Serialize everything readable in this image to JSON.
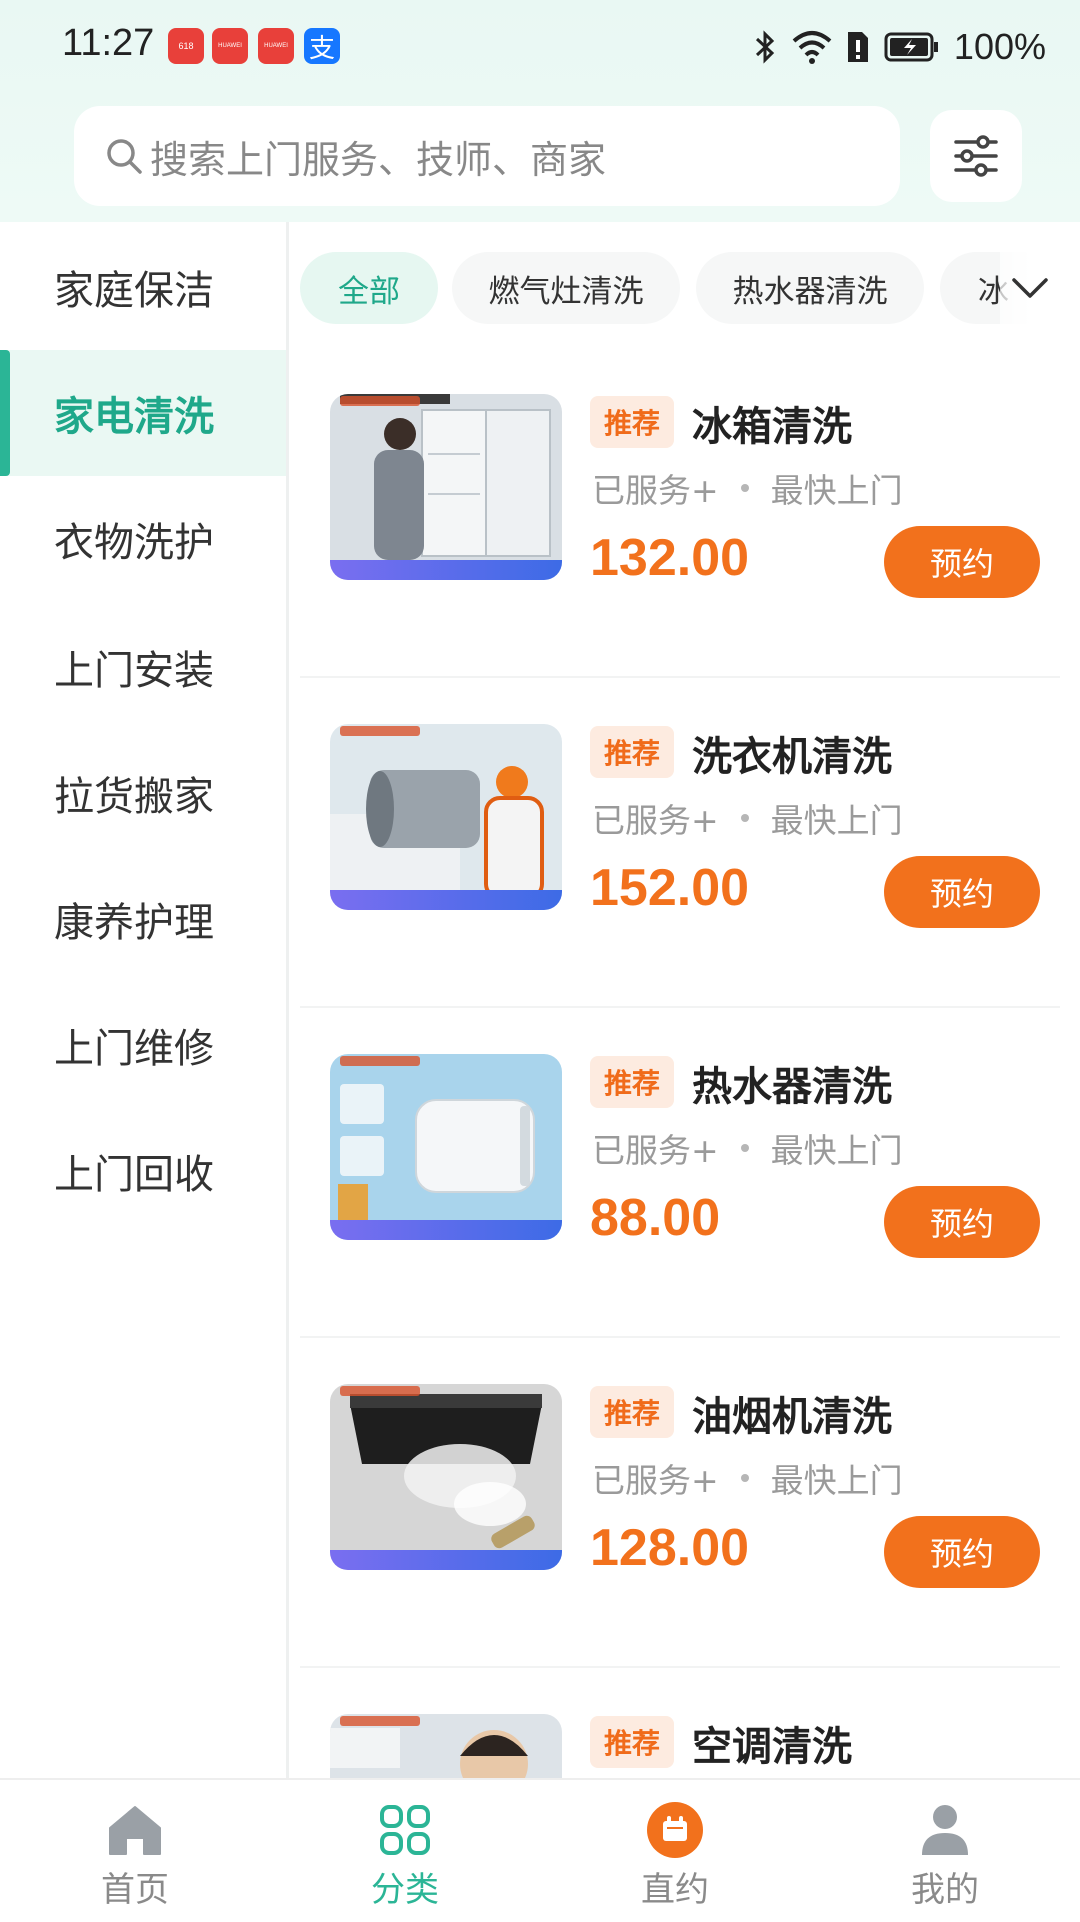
{
  "status_bar": {
    "time": "11:27",
    "battery": "100%",
    "app_icons": [
      {
        "name": "618-app-icon",
        "label": "618",
        "color": "#e8403a"
      },
      {
        "name": "huawei-app-icon",
        "label": "HUAWEI",
        "color": "#e8403a"
      },
      {
        "name": "huawei-app-icon",
        "label": "HUAWEI",
        "color": "#e8403a"
      },
      {
        "name": "alipay-app-icon",
        "label": "支",
        "color": "#1677ff"
      }
    ]
  },
  "search": {
    "placeholder": "搜索上门服务、技师、商家"
  },
  "sidebar": {
    "items": [
      {
        "label": "家庭保洁",
        "active": false
      },
      {
        "label": "家电清洗",
        "active": true
      },
      {
        "label": "衣物洗护",
        "active": false
      },
      {
        "label": "上门安装",
        "active": false
      },
      {
        "label": "拉货搬家",
        "active": false
      },
      {
        "label": "康养护理",
        "active": false
      },
      {
        "label": "上门维修",
        "active": false
      },
      {
        "label": "上门回收",
        "active": false
      }
    ]
  },
  "chips": [
    {
      "label": "全部",
      "active": true
    },
    {
      "label": "燃气灶清洗",
      "active": false
    },
    {
      "label": "热水器清洗",
      "active": false
    },
    {
      "label": "冰",
      "active": false
    }
  ],
  "services": [
    {
      "tag": "推荐",
      "title": "冰箱清洗",
      "served": "已服务+",
      "fast": "最快上门",
      "price": "132.00",
      "book": "预约",
      "thumb": "fridge-cleaning-thumb"
    },
    {
      "tag": "推荐",
      "title": "洗衣机清洗",
      "served": "已服务+",
      "fast": "最快上门",
      "price": "152.00",
      "book": "预约",
      "thumb": "washer-cleaning-thumb"
    },
    {
      "tag": "推荐",
      "title": "热水器清洗",
      "served": "已服务+",
      "fast": "最快上门",
      "price": "88.00",
      "book": "预约",
      "thumb": "water-heater-cleaning-thumb"
    },
    {
      "tag": "推荐",
      "title": "油烟机清洗",
      "served": "已服务+",
      "fast": "最快上门",
      "price": "128.00",
      "book": "预约",
      "thumb": "range-hood-cleaning-thumb"
    },
    {
      "tag": "推荐",
      "title": "空调清洗",
      "served": "",
      "fast": "",
      "price": "",
      "book": "",
      "thumb": "ac-cleaning-thumb"
    }
  ],
  "tabbar": {
    "items": [
      {
        "label": "首页",
        "icon": "home-icon",
        "active": false
      },
      {
        "label": "分类",
        "icon": "grid-icon",
        "active": true
      },
      {
        "label": "直约",
        "icon": "calendar-icon",
        "active": false
      },
      {
        "label": "我的",
        "icon": "person-icon",
        "active": false
      }
    ]
  },
  "colors": {
    "accent": "#2bb596",
    "price": "#f2711c",
    "tag_bg": "#fdebe0"
  }
}
